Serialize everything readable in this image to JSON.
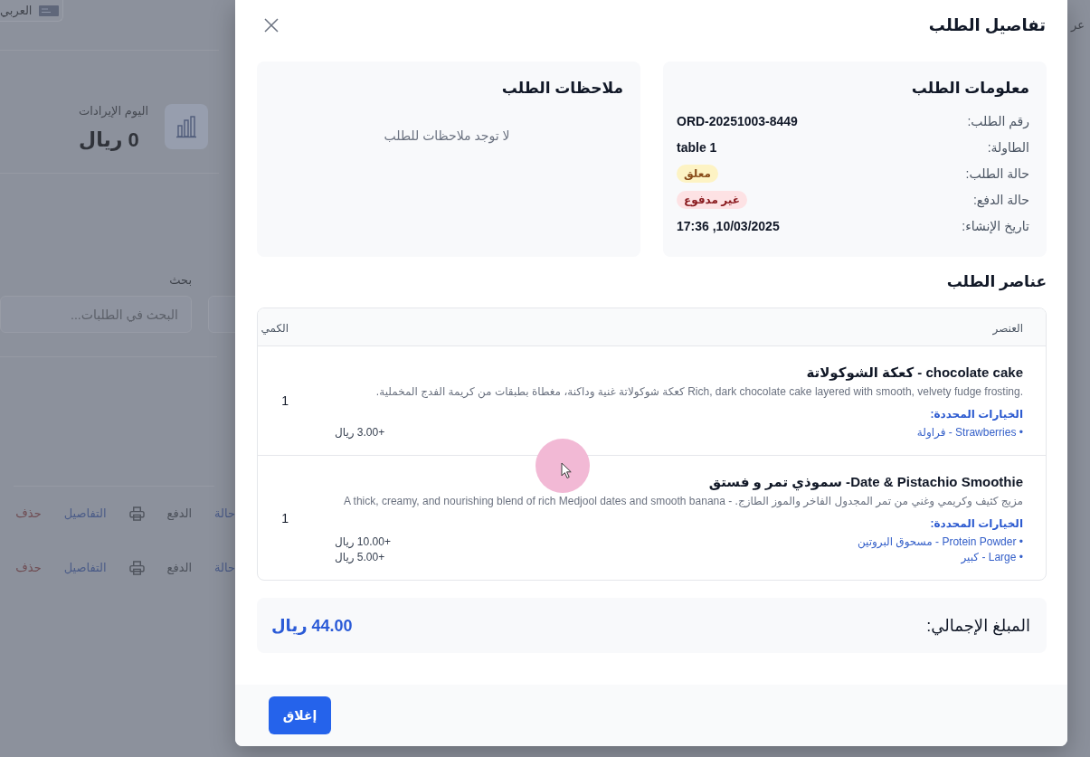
{
  "background": {
    "language": {
      "label": "العربي"
    },
    "revenue": {
      "label": "اليوم الإيرادات",
      "value": "0 ريال"
    },
    "search": {
      "label": "بحث",
      "placeholder": "البحث في الطلبات..."
    },
    "order_rows": [
      {
        "actions": [
          {
            "kind": "link",
            "label": "حالة"
          },
          {
            "kind": "plain",
            "label": "الدفع"
          },
          {
            "kind": "print"
          },
          {
            "kind": "link",
            "label": "التفاصيل"
          },
          {
            "kind": "danger",
            "label": "حذف"
          }
        ]
      },
      {
        "actions": [
          {
            "kind": "link",
            "label": "حالة"
          },
          {
            "kind": "plain",
            "label": "الدفع"
          },
          {
            "kind": "print"
          },
          {
            "kind": "link",
            "label": "التفاصيل"
          },
          {
            "kind": "danger",
            "label": "حذف"
          }
        ]
      }
    ],
    "edge_text": "عر"
  },
  "modal": {
    "title": "تفاصيل الطلب",
    "info_card": {
      "title": "معلومات الطلب",
      "rows": [
        {
          "kind": "text",
          "label": "رقم الطلب:",
          "value": "ORD-20251003-8449"
        },
        {
          "kind": "text",
          "label": "الطاولة:",
          "value": "table 1"
        },
        {
          "kind": "badge",
          "label": "حالة الطلب:",
          "value": "معلق",
          "color": "#fdf3c4"
        },
        {
          "kind": "badge",
          "label": "حالة الدفع:",
          "value": "غير مدفوع",
          "color": "#fde2e4"
        },
        {
          "kind": "text",
          "label": "تاريخ الإنشاء:",
          "value": "10/03/2025, 17:36"
        }
      ]
    },
    "notes_card": {
      "title": "ملاحظات الطلب",
      "empty_text": "لا توجد ملاحظات للطلب"
    },
    "items_section": {
      "title": "عناصر الطلب",
      "columns": [
        "العنصر",
        "الكمي"
      ],
      "rows": [
        {
          "name": "chocolate cake - كعكة الشوكولاتة",
          "description": [
            "Rich, dark chocolate cake layered with smooth, velvety fudge frosting.",
            "كعكة شوكولاتة غنية وداكنة، مغطاة بطبقات من كريمة الفدج المخملية."
          ],
          "options_label": "الخيارات المحددة:",
          "options": [
            {
              "label": "• Strawberries - فراولة",
              "price": "+3.00 ريال"
            }
          ],
          "quantity": "1"
        },
        {
          "name": "Date & Pistachio Smoothie- سموذي تمر و فستق",
          "description": [
            "مزيج كثيف وكريمي وغني من تمر المجدول الفاخر والموز الطازج. - A thick, creamy, and nourishing blend of rich Medjool dates and smooth banana"
          ],
          "options_label": "الخيارات المحددة:",
          "options": [
            {
              "label": "• Protein Powder - مسحوق البروتين",
              "price": "+10.00 ريال"
            },
            {
              "label": "• Large - كبير",
              "price": "+5.00 ريال"
            }
          ],
          "quantity": "1"
        }
      ]
    },
    "total": {
      "label": "المبلغ الإجمالي:",
      "value": "44.00 ريال"
    },
    "buttons": [
      {
        "label": "إغلاق"
      }
    ]
  }
}
